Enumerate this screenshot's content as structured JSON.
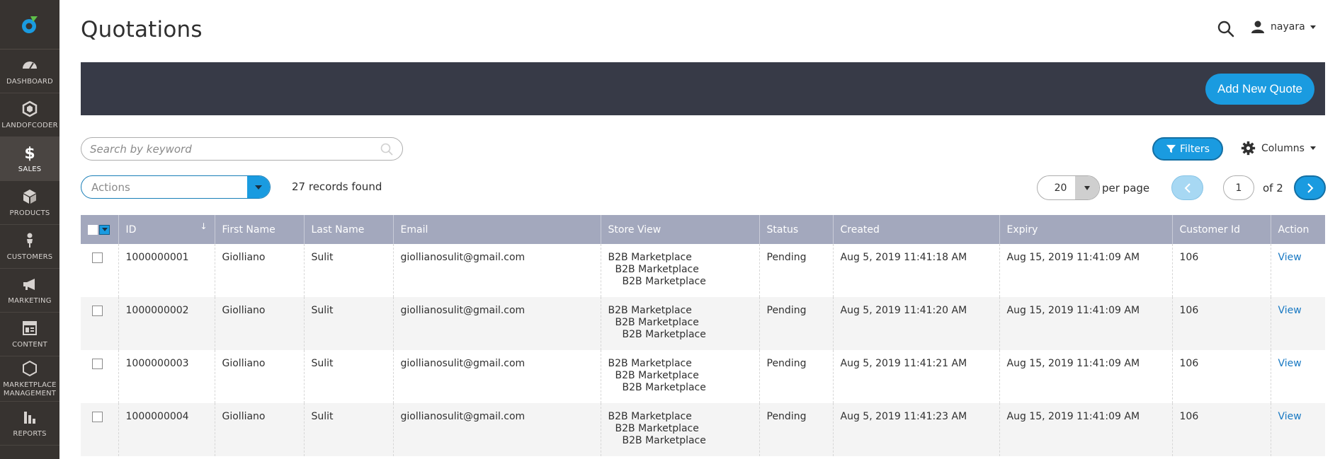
{
  "sidebar": {
    "items": [
      {
        "label": "DASHBOARD",
        "icon": "dashboard-icon"
      },
      {
        "label": "LANDOFCODER",
        "icon": "landofcoder-icon"
      },
      {
        "label": "SALES",
        "icon": "dollar-icon",
        "active": true
      },
      {
        "label": "PRODUCTS",
        "icon": "cube-icon"
      },
      {
        "label": "CUSTOMERS",
        "icon": "person-icon"
      },
      {
        "label": "MARKETING",
        "icon": "megaphone-icon"
      },
      {
        "label": "CONTENT",
        "icon": "layout-icon"
      },
      {
        "label": "MARKETPLACE MANAGEMENT",
        "icon": "hexagon-icon"
      },
      {
        "label": "REPORTS",
        "icon": "bar-chart-icon"
      }
    ]
  },
  "header": {
    "title": "Quotations",
    "username": "nayara"
  },
  "toolbar": {
    "add_new_label": "Add New Quote",
    "search_placeholder": "Search by keyword",
    "filters_label": "Filters",
    "columns_label": "Columns",
    "actions_label": "Actions",
    "records_found": "27 records found",
    "per_page_value": "20",
    "per_page_label": "per page",
    "current_page": "1",
    "of_pages": "of 2"
  },
  "table": {
    "headers": [
      "ID",
      "First Name",
      "Last Name",
      "Email",
      "Store View",
      "Status",
      "Created",
      "Expiry",
      "Customer Id",
      "Action"
    ],
    "rows": [
      {
        "id": "1000000001",
        "first_name": "Giolliano",
        "last_name": "Sulit",
        "email": "giollianosulit@gmail.com",
        "store_view": [
          "B2B Marketplace",
          "B2B Marketplace",
          "B2B Marketplace"
        ],
        "status": "Pending",
        "created": "Aug 5, 2019 11:41:18 AM",
        "expiry": "Aug 15, 2019 11:41:09 AM",
        "customer_id": "106",
        "action": "View"
      },
      {
        "id": "1000000002",
        "first_name": "Giolliano",
        "last_name": "Sulit",
        "email": "giollianosulit@gmail.com",
        "store_view": [
          "B2B Marketplace",
          "B2B Marketplace",
          "B2B Marketplace"
        ],
        "status": "Pending",
        "created": "Aug 5, 2019 11:41:20 AM",
        "expiry": "Aug 15, 2019 11:41:09 AM",
        "customer_id": "106",
        "action": "View"
      },
      {
        "id": "1000000003",
        "first_name": "Giolliano",
        "last_name": "Sulit",
        "email": "giollianosulit@gmail.com",
        "store_view": [
          "B2B Marketplace",
          "B2B Marketplace",
          "B2B Marketplace"
        ],
        "status": "Pending",
        "created": "Aug 5, 2019 11:41:21 AM",
        "expiry": "Aug 15, 2019 11:41:09 AM",
        "customer_id": "106",
        "action": "View"
      },
      {
        "id": "1000000004",
        "first_name": "Giolliano",
        "last_name": "Sulit",
        "email": "giollianosulit@gmail.com",
        "store_view": [
          "B2B Marketplace",
          "B2B Marketplace",
          "B2B Marketplace"
        ],
        "status": "Pending",
        "created": "Aug 5, 2019 11:41:23 AM",
        "expiry": "Aug 15, 2019 11:41:09 AM",
        "customer_id": "106",
        "action": "View"
      }
    ]
  },
  "colors": {
    "sidebar_bg": "#373330",
    "action_bar_bg": "#373a47",
    "accent": "#1a9be0",
    "table_header_bg": "#a3a8bd",
    "link": "#1979c3"
  }
}
